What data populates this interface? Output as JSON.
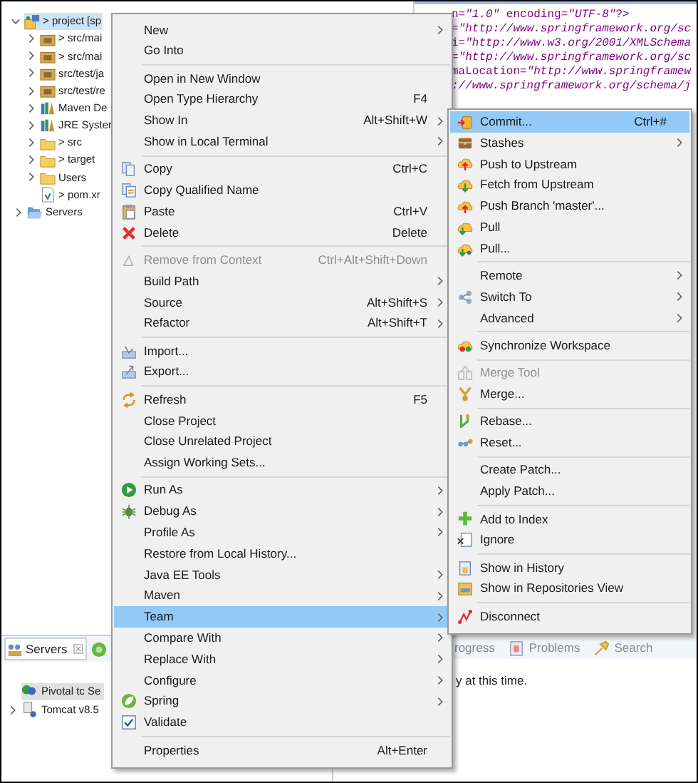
{
  "explorer": {
    "tree": [
      {
        "label": "> project [sp",
        "kind": "project",
        "expanded": true,
        "selected": true,
        "children": [
          {
            "label": "> src/mai",
            "kind": "source-folder",
            "expanded": false,
            "selected": false
          },
          {
            "label": "> src/mai",
            "kind": "source-folder",
            "expanded": false,
            "selected": false
          },
          {
            "label": "src/test/ja",
            "kind": "source-folder",
            "expanded": false,
            "selected": false
          },
          {
            "label": "src/test/re",
            "kind": "source-folder",
            "expanded": false,
            "selected": false
          },
          {
            "label": "Maven De",
            "kind": "library",
            "expanded": false,
            "selected": false
          },
          {
            "label": "JRE Syster",
            "kind": "library",
            "expanded": false,
            "selected": false
          },
          {
            "label": "> src",
            "kind": "folder",
            "expanded": false,
            "selected": false
          },
          {
            "label": "> target",
            "kind": "folder",
            "expanded": false,
            "selected": false
          },
          {
            "label": "Users",
            "kind": "folder",
            "expanded": false,
            "selected": false
          },
          {
            "label": "> pom.xr",
            "kind": "xml-file",
            "selected": false
          }
        ]
      },
      {
        "label": "Servers",
        "kind": "open-folder",
        "expanded": false,
        "selected": false
      }
    ]
  },
  "editor": {
    "lines": [
      "n=*\"1.0\"* encoding=*\"UTF-8\"*?>",
      "=*\"http://www.springframework.org/sc*",
      "i=*\"http://www.w3.org/2001/XMLSchema*",
      "=*\"http://www.springframework.org/sc*",
      "maLocation=*\"http://www.springframew*",
      "*://www.springframework.org/schema/j*"
    ]
  },
  "servers_view": {
    "tab": {
      "label": "Servers",
      "selected": true
    },
    "tree": [
      {
        "label": "Pivotal tc Se",
        "kind": "leaf",
        "selected": true
      },
      {
        "label": "Tomcat v8.5",
        "kind": "node",
        "selected": false
      }
    ]
  },
  "bottom_view": {
    "tabs": [
      {
        "label": "rogress",
        "selected": false
      },
      {
        "label": "Problems",
        "selected": false
      },
      {
        "label": "Search",
        "selected": false
      }
    ],
    "message": "y at this time."
  },
  "context_menu": {
    "groups": [
      [
        {
          "label": "New",
          "submenu": true,
          "disabled": false,
          "selected": false
        },
        {
          "label": "Go Into",
          "submenu": false,
          "disabled": false,
          "selected": false
        }
      ],
      [
        {
          "label": "Open in New Window",
          "submenu": false,
          "disabled": false,
          "selected": false
        },
        {
          "label": "Open Type Hierarchy",
          "shortcut": "F4",
          "submenu": false,
          "disabled": false,
          "selected": false
        },
        {
          "label": "Show In",
          "shortcut": "Alt+Shift+W",
          "submenu": true,
          "disabled": false,
          "selected": false
        },
        {
          "label": "Show in Local Terminal",
          "submenu": true,
          "disabled": false,
          "selected": false
        }
      ],
      [
        {
          "label": "Copy",
          "shortcut": "Ctrl+C",
          "submenu": false,
          "disabled": false,
          "selected": false
        },
        {
          "label": "Copy Qualified Name",
          "submenu": false,
          "disabled": false,
          "selected": false
        },
        {
          "label": "Paste",
          "shortcut": "Ctrl+V",
          "submenu": false,
          "disabled": false,
          "selected": false
        },
        {
          "label": "Delete",
          "shortcut": "Delete",
          "submenu": false,
          "disabled": false,
          "selected": false
        }
      ],
      [
        {
          "label": "Remove from Context",
          "shortcut": "Ctrl+Alt+Shift+Down",
          "submenu": false,
          "disabled": true,
          "selected": false
        },
        {
          "label": "Build Path",
          "submenu": true,
          "disabled": false,
          "selected": false
        },
        {
          "label": "Source",
          "shortcut": "Alt+Shift+S",
          "submenu": true,
          "disabled": false,
          "selected": false
        },
        {
          "label": "Refactor",
          "shortcut": "Alt+Shift+T",
          "submenu": true,
          "disabled": false,
          "selected": false
        }
      ],
      [
        {
          "label": "Import...",
          "submenu": false,
          "disabled": false,
          "selected": false
        },
        {
          "label": "Export...",
          "submenu": false,
          "disabled": false,
          "selected": false
        }
      ],
      [
        {
          "label": "Refresh",
          "shortcut": "F5",
          "submenu": false,
          "disabled": false,
          "selected": false
        },
        {
          "label": "Close Project",
          "submenu": false,
          "disabled": false,
          "selected": false
        },
        {
          "label": "Close Unrelated Project",
          "submenu": false,
          "disabled": false,
          "selected": false
        },
        {
          "label": "Assign Working Sets...",
          "submenu": false,
          "disabled": false,
          "selected": false
        }
      ],
      [
        {
          "label": "Run As",
          "submenu": true,
          "disabled": false,
          "selected": false
        },
        {
          "label": "Debug As",
          "submenu": true,
          "disabled": false,
          "selected": false
        },
        {
          "label": "Profile As",
          "submenu": true,
          "disabled": false,
          "selected": false
        },
        {
          "label": "Restore from Local History...",
          "submenu": false,
          "disabled": false,
          "selected": false
        },
        {
          "label": "Java EE Tools",
          "submenu": true,
          "disabled": false,
          "selected": false
        },
        {
          "label": "Maven",
          "submenu": true,
          "disabled": false,
          "selected": false
        },
        {
          "label": "Team",
          "submenu": true,
          "disabled": false,
          "selected": true
        },
        {
          "label": "Compare With",
          "submenu": true,
          "disabled": false,
          "selected": false
        },
        {
          "label": "Replace With",
          "submenu": true,
          "disabled": false,
          "selected": false
        },
        {
          "label": "Configure",
          "submenu": true,
          "disabled": false,
          "selected": false
        },
        {
          "label": "Spring",
          "submenu": true,
          "disabled": false,
          "selected": false
        },
        {
          "label": "Validate",
          "submenu": false,
          "disabled": false,
          "selected": false
        }
      ],
      [
        {
          "label": "Properties",
          "shortcut": "Alt+Enter",
          "submenu": false,
          "disabled": false,
          "selected": false
        }
      ]
    ]
  },
  "team_submenu": {
    "groups": [
      [
        {
          "label": "Commit...",
          "shortcut": "Ctrl+#",
          "submenu": false,
          "disabled": false,
          "selected": true
        },
        {
          "label": "Stashes",
          "submenu": true,
          "disabled": false,
          "selected": false
        },
        {
          "label": "Push to Upstream",
          "submenu": false,
          "disabled": false,
          "selected": false
        },
        {
          "label": "Fetch from Upstream",
          "submenu": false,
          "disabled": false,
          "selected": false
        },
        {
          "label": "Push Branch 'master'...",
          "submenu": false,
          "disabled": false,
          "selected": false
        },
        {
          "label": "Pull",
          "submenu": false,
          "disabled": false,
          "selected": false
        },
        {
          "label": "Pull...",
          "submenu": false,
          "disabled": false,
          "selected": false
        }
      ],
      [
        {
          "label": "Remote",
          "submenu": true,
          "disabled": false,
          "selected": false
        },
        {
          "label": "Switch To",
          "submenu": true,
          "disabled": false,
          "selected": false
        },
        {
          "label": "Advanced",
          "submenu": true,
          "disabled": false,
          "selected": false
        }
      ],
      [
        {
          "label": "Synchronize Workspace",
          "submenu": false,
          "disabled": false,
          "selected": false
        }
      ],
      [
        {
          "label": "Merge Tool",
          "submenu": false,
          "disabled": true,
          "selected": false
        },
        {
          "label": "Merge...",
          "submenu": false,
          "disabled": false,
          "selected": false
        }
      ],
      [
        {
          "label": "Rebase...",
          "submenu": false,
          "disabled": false,
          "selected": false
        },
        {
          "label": "Reset...",
          "submenu": false,
          "disabled": false,
          "selected": false
        }
      ],
      [
        {
          "label": "Create Patch...",
          "submenu": false,
          "disabled": false,
          "selected": false
        },
        {
          "label": "Apply Patch...",
          "submenu": false,
          "disabled": false,
          "selected": false
        }
      ],
      [
        {
          "label": "Add to Index",
          "submenu": false,
          "disabled": false,
          "selected": false
        },
        {
          "label": "Ignore",
          "submenu": false,
          "disabled": false,
          "selected": false
        }
      ],
      [
        {
          "label": "Show in History",
          "submenu": false,
          "disabled": false,
          "selected": false
        },
        {
          "label": "Show in Repositories View",
          "submenu": false,
          "disabled": false,
          "selected": false
        }
      ],
      [
        {
          "label": "Disconnect",
          "submenu": false,
          "disabled": false,
          "selected": false
        }
      ]
    ]
  }
}
